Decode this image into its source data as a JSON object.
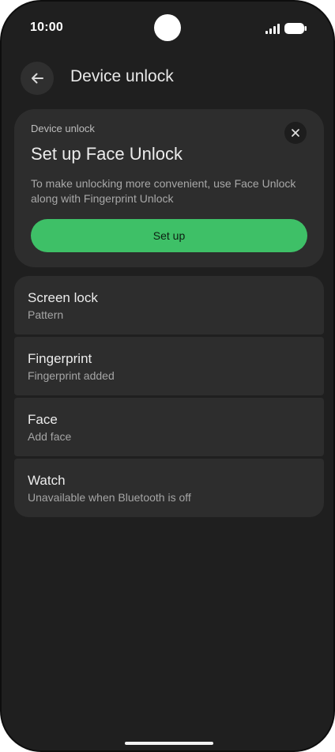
{
  "status_bar": {
    "time": "10:00"
  },
  "header": {
    "title": "Device unlock"
  },
  "suggestion_card": {
    "eyebrow": "Device unlock",
    "title": "Set up Face Unlock",
    "description": "To make unlocking more convenient, use Face Unlock along with Fingerprint Unlock",
    "button_label": "Set up",
    "accent_color": "#3ec067"
  },
  "settings": {
    "items": [
      {
        "title": "Screen lock",
        "subtitle": "Pattern"
      },
      {
        "title": "Fingerprint",
        "subtitle": "Fingerprint added"
      },
      {
        "title": "Face",
        "subtitle": "Add face"
      },
      {
        "title": "Watch",
        "subtitle": "Unavailable when Bluetooth is off"
      }
    ]
  },
  "icons": {
    "back": "arrow-back-icon",
    "close": "close-icon",
    "signal": "cellular-signal-icon",
    "battery": "battery-icon"
  }
}
